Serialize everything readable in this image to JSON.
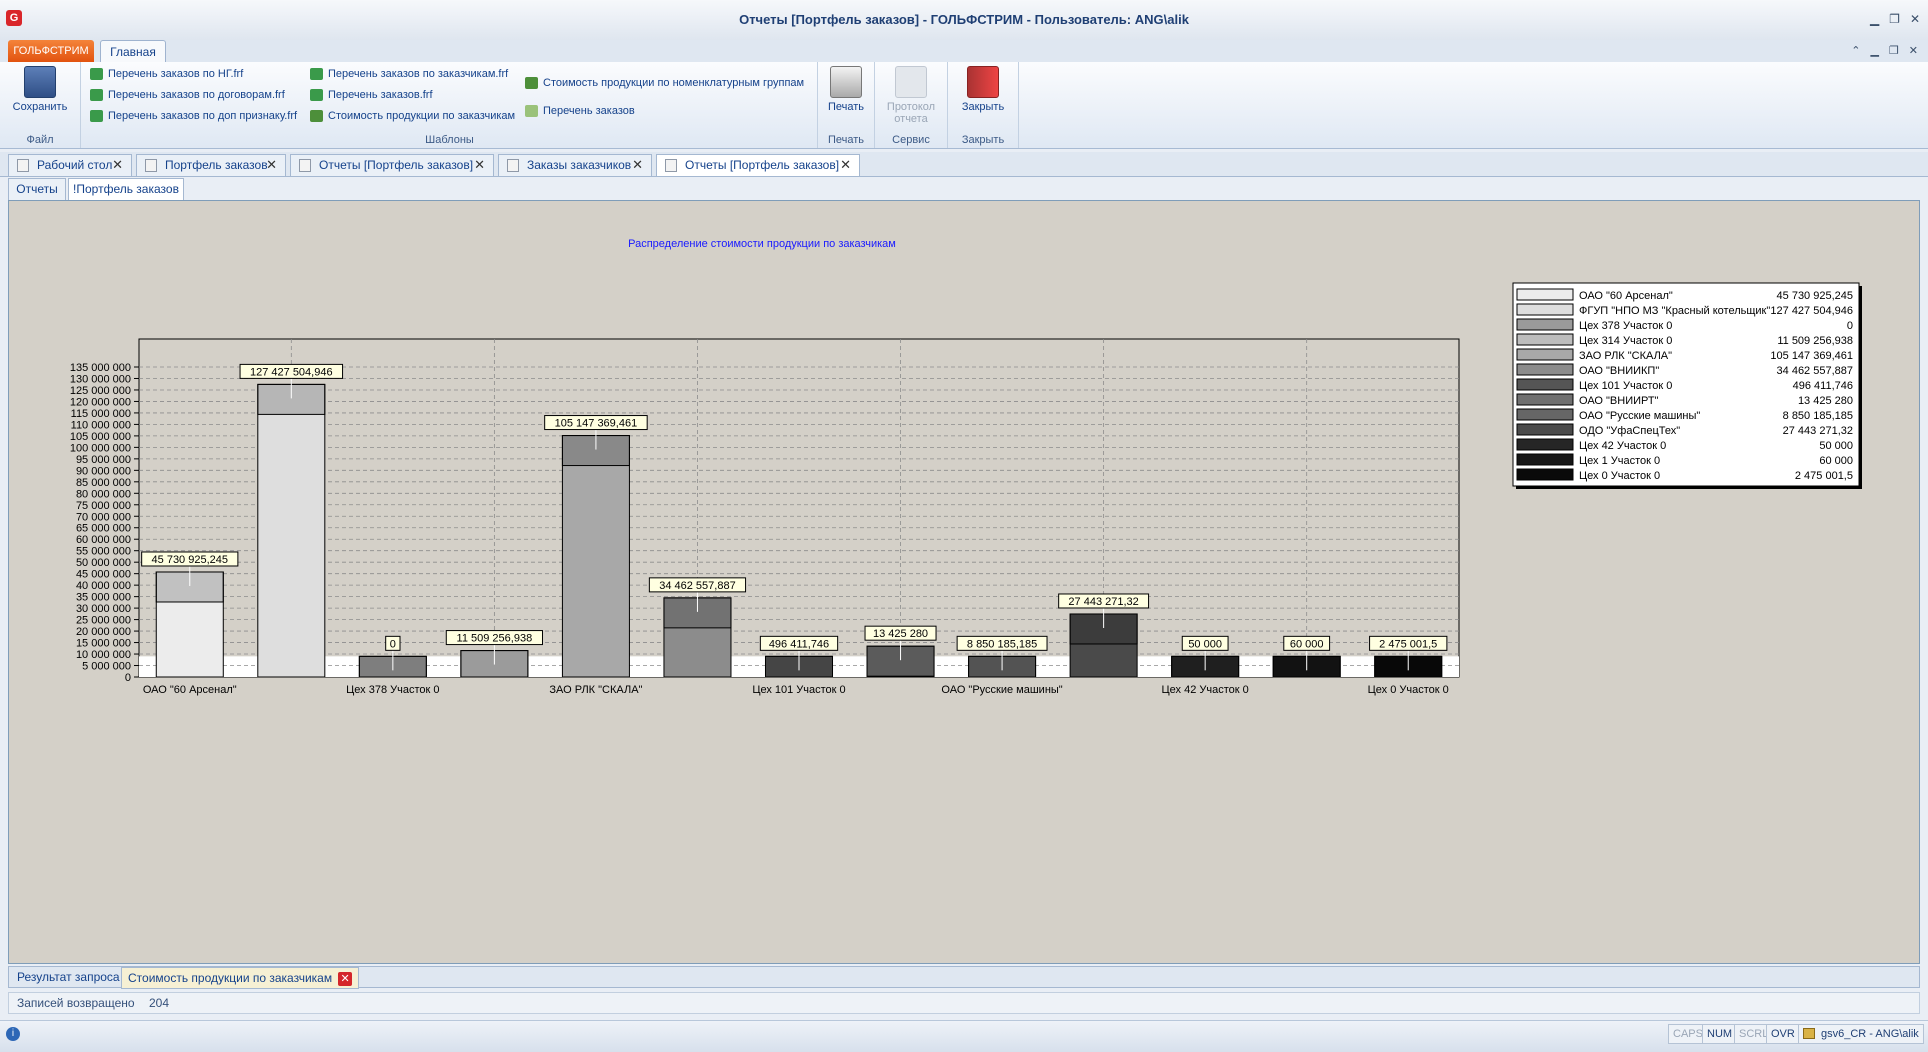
{
  "window": {
    "title": "Отчеты  [Портфель заказов] - ГОЛЬФСТРИМ - Пользователь: ANG\\alik",
    "app_icon_letter": "G"
  },
  "ribbon": {
    "app_tab": "ГОЛЬФСТРИМ",
    "main_tab": "Главная",
    "file_group": {
      "label": "Файл",
      "save": "Сохранить"
    },
    "templates_group": {
      "label": "Шаблоны",
      "col1": [
        "Перечень заказов по НГ.frf",
        "Перечень заказов по договорам.frf",
        "Перечень заказов по доп признаку.frf"
      ],
      "col2": [
        "Перечень заказов по заказчикам.frf",
        "Перечень заказов.frf",
        "Стоимость продукции по заказчикам"
      ],
      "col3": [
        "Стоимость продукции по номенклатурным группам",
        "Перечень заказов"
      ]
    },
    "print_group": {
      "label": "Печать",
      "print": "Печать"
    },
    "service_group": {
      "label": "Сервис",
      "protocol_line1": "Протокол",
      "protocol_line2": "отчета"
    },
    "close_group": {
      "label": "Закрыть",
      "close": "Закрыть"
    }
  },
  "doc_tabs": [
    "Рабочий стол",
    "Портфель заказов",
    "Отчеты  [Портфель заказов]",
    "Заказы заказчиков",
    "Отчеты  [Портфель заказов]"
  ],
  "sub_tabs": [
    "Отчеты",
    "!Портфель заказов"
  ],
  "chart_data": {
    "type": "bar",
    "title": "Распределение стоимости продукции по заказчикам",
    "ylim": [
      0,
      135000000
    ],
    "yticks": [
      "0",
      "5 000 000",
      "10 000 000",
      "15 000 000",
      "20 000 000",
      "25 000 000",
      "30 000 000",
      "35 000 000",
      "40 000 000",
      "45 000 000",
      "50 000 000",
      "55 000 000",
      "60 000 000",
      "65 000 000",
      "70 000 000",
      "75 000 000",
      "80 000 000",
      "85 000 000",
      "90 000 000",
      "95 000 000",
      "100 000 000",
      "105 000 000",
      "110 000 000",
      "115 000 000",
      "120 000 000",
      "125 000 000",
      "130 000 000",
      "135 000 000"
    ],
    "categories": [
      "ОАО \"60 Арсенал\"",
      "ФГУП \"НПО МЗ \"Красный котельщик\"",
      "Цех 378 Участок 0",
      "Цех 314 Участок 0",
      "ЗАО РЛК \"СКАЛА\"",
      "ОАО \"ВНИИКП\"",
      "Цех 101 Участок 0",
      "ОАО \"ВНИИРТ\"",
      "ОАО \"Русские машины\"",
      "ОДО \"УфаСпецТех\"",
      "Цех 42 Участок 0",
      "Цех 1 Участок 0",
      "Цех 0 Участок 0"
    ],
    "x_tick_labels": [
      "ОАО \"60 Арсенал\"",
      "",
      "Цех 378 Участок 0",
      "",
      "ЗАО РЛК \"СКАЛА\"",
      "",
      "Цех 101 Участок 0",
      "",
      "ОАО \"Русские машины\"",
      "",
      "Цех 42 Участок 0",
      "",
      "Цех 0 Участок 0"
    ],
    "values": [
      45730925.245,
      127427504.946,
      0,
      11509256.938,
      105147369.461,
      34462557.887,
      496411.746,
      13425280,
      8850185.185,
      27443271.32,
      50000,
      60000,
      2475001.5
    ],
    "value_labels": [
      "45 730 925,245",
      "127 427 504,946",
      "0",
      "11 509 256,938",
      "105 147 369,461",
      "34 462 557,887",
      "496 411,746",
      "13 425 280",
      "8 850 185,185",
      "27 443 271,32",
      "50 000",
      "60 000",
      "2 475 001,5"
    ],
    "colors": [
      "#ececec",
      "#dedede",
      "#9a9a9a",
      "#bdbdbd",
      "#a8a8a8",
      "#8c8c8c",
      "#555555",
      "#707070",
      "#666666",
      "#4a4a4a",
      "#262626",
      "#161616",
      "#0a0a0a"
    ],
    "legend_position": "top-right",
    "grid": true
  },
  "bottom_tabs": {
    "result": "Результат запроса",
    "active": "Стоимость продукции по заказчикам"
  },
  "records": {
    "label": "Записей возвращено",
    "count": "204"
  },
  "status": {
    "indicators": [
      "CAPS",
      "NUM",
      "SCRL",
      "OVR"
    ],
    "user": "gsv6_CR - ANG\\alik"
  }
}
